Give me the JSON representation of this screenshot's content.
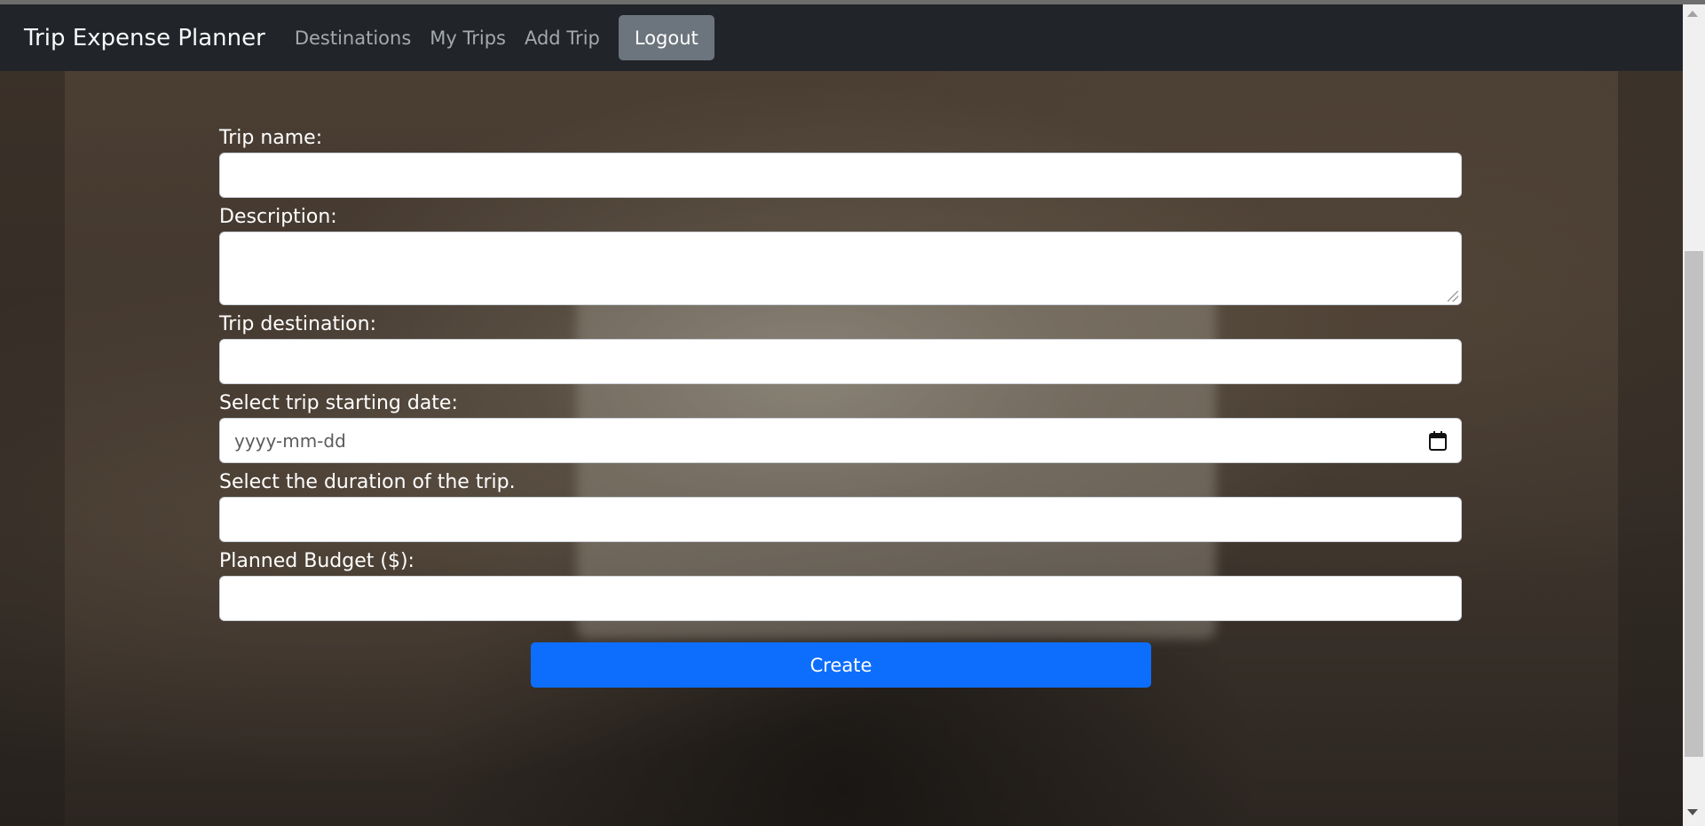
{
  "navbar": {
    "brand": "Trip Expense Planner",
    "links": [
      "Destinations",
      "My Trips",
      "Add Trip"
    ],
    "logout_label": "Logout"
  },
  "form": {
    "trip_name_label": "Trip name:",
    "trip_name_value": "",
    "description_label": "Description:",
    "description_value": "",
    "destination_label": "Trip destination:",
    "destination_value": "",
    "start_date_label": "Select trip starting date:",
    "start_date_placeholder": "yyyy-mm-dd",
    "duration_label": "Select the duration of the trip.",
    "duration_value": "",
    "budget_label": "Planned Budget ($):",
    "budget_value": "",
    "submit_label": "Create"
  },
  "icons": {
    "date_picker": "calendar-icon"
  },
  "colors": {
    "navbar_bg": "#212529",
    "logout_bg": "#6c757d",
    "primary_button": "#0d6efd"
  }
}
